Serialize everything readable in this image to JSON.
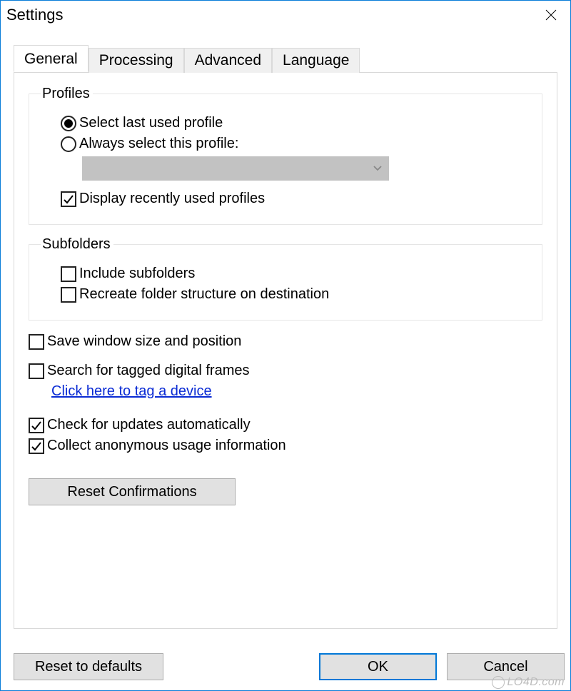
{
  "window": {
    "title": "Settings"
  },
  "tabs": [
    "General",
    "Processing",
    "Advanced",
    "Language"
  ],
  "activeTab": 0,
  "profiles": {
    "legend": "Profiles",
    "radio_last": "Select last used profile",
    "radio_always": "Always select this profile:",
    "combo_value": "",
    "display_recent": "Display recently used profiles"
  },
  "subfolders": {
    "legend": "Subfolders",
    "include": "Include subfolders",
    "recreate": "Recreate folder structure on destination"
  },
  "options": {
    "save_window": "Save window size and position",
    "search_frames": "Search for tagged digital frames",
    "tag_link": "Click here to tag a device",
    "check_updates": "Check for updates automatically",
    "collect_usage": "Collect anonymous usage information"
  },
  "buttons": {
    "reset_conf": "Reset Confirmations",
    "reset_defaults": "Reset to defaults",
    "ok": "OK",
    "cancel": "Cancel"
  },
  "watermark": "LO4D.com"
}
